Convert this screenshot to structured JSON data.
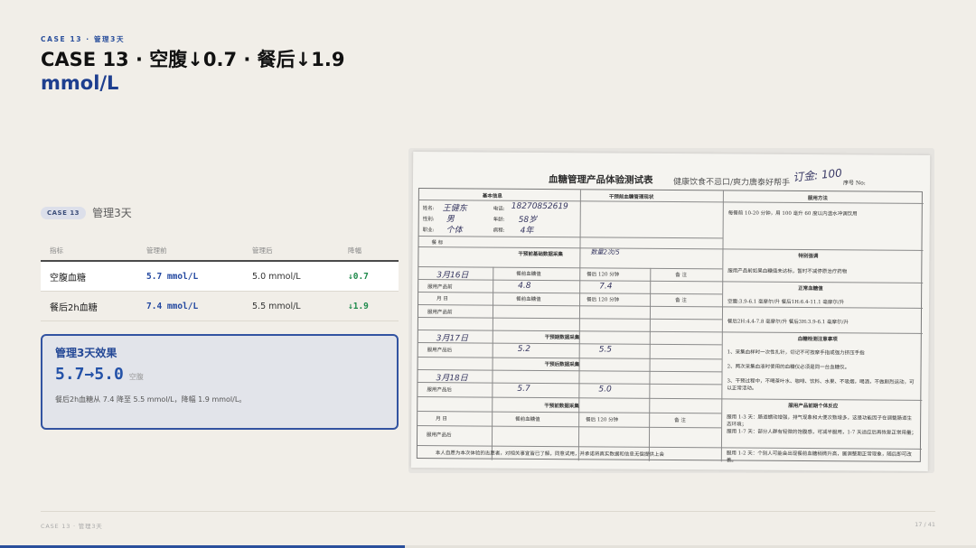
{
  "header": {
    "eyebrow": "CASE 13 · 管理3天",
    "title": "CASE 13 · 空腹↓0.7 · 餐后↓1.9",
    "title_unit": "mmol/L"
  },
  "case_tag": {
    "pill": "CASE 13",
    "label": "管理3天"
  },
  "table": {
    "headers": [
      "指标",
      "管理前",
      "管理后",
      "降幅"
    ],
    "rows": [
      {
        "metric": "空腹血糖",
        "before": "5.7 mmol/L",
        "after": "5.0 mmol/L",
        "drop": "↓0.7"
      },
      {
        "metric": "餐后2h血糖",
        "before": "7.4 mmol/L",
        "after": "5.5 mmol/L",
        "drop": "↓1.9"
      }
    ]
  },
  "effect": {
    "heading": "管理3天效果",
    "value": "5.7→5.0",
    "value_label": "空腹",
    "description": "餐后2h血糖从 7.4 降至 5.5 mmol/L，降幅 1.9 mmol/L。"
  },
  "photo": {
    "title": "血糖管理产品体验测试表",
    "slogan": "健康饮食不忌口/爽力唐泰好帮手",
    "seq": "序号 No:",
    "signature": "订金: 100",
    "sections": {
      "basic": "基本信息",
      "pre_status": "干预前血糖管理现状",
      "usage": "服用方法",
      "pre_data": "干预前基础数据采集",
      "special": "特别强调",
      "normal": "正常血糖值",
      "mid_data": "干预期数据采集",
      "mid_data2": "干预后数据采集",
      "post_data": "干预前数据采集",
      "notes": "血糖检测注意事项",
      "reaction": "服用产品前期个体反应"
    },
    "labels": {
      "name": "姓名:",
      "phone": "电话:",
      "gender": "性别:",
      "age": "年龄:",
      "job": "职业:",
      "course": "病程:",
      "meal": "餐 标",
      "date": "月 日",
      "fasting": "餐前血糖值",
      "post120": "餐后 120 分钟",
      "remark": "备 注",
      "before_use": "服用产品前",
      "after_use": "服用产品后"
    },
    "handwriting": {
      "name": "王健东",
      "phone": "18270852619",
      "gender": "男",
      "age": "58岁",
      "job": "个体",
      "course": "4年",
      "date1": "3月16日",
      "v1a": "4.8",
      "v1b": "7.4",
      "date2": "3月17日",
      "v2a": "5.2",
      "v2b": "5.5",
      "date3": "3月18日",
      "v3a": "5.7",
      "v3b": "5.0",
      "note_top": "数量2次/5"
    },
    "printed": {
      "usage_text": "每餐前 10-20 分钟，用 100 毫升 60 度以内温水冲调饮用",
      "special_text": "服用产品前如果血糖值未达标，暂时不减停原治疗药物",
      "normal_text1": "空腹:3.9-6.1 毫摩尔/升  餐后1H:6.4-11.1 毫摩尔/升",
      "normal_text2": "餐后2H:4.4-7.8 毫摩尔/升  餐后3H:3.9-6.1 毫摩尔/升",
      "note1": "1、采集血样时一次性扎针，切记不可按摩手指或强力挤压手指",
      "note2": "2、两次采集血液时使用的血糖仪必须是同一台血糖仪。",
      "note3": "3、干预过程中，不喝茶叶水、咖啡、饮料、水果、不吸烟，喝酒，不做剧烈运动，可以正常活动。",
      "react1": "服用 1-3 天：肠道蠕动增强，排气现象和大便次数增多，这是功能因子在调整肠道生态环境；",
      "react2": "服用 1-7 天：部分人群有轻微的饱腹感，可减半服用，1-7 天适应后再恢复正常用量；",
      "react3": "服用 1-2 天：个别人可能会出现餐前血糖稍微升高，属调整期正常现象，随后即可改善。",
      "consent": "本人自愿为本次体验的志愿者，对相关事宜皆已了解，同意试用，并承诺将真实数据和信息无偿提供上会"
    }
  },
  "footer": {
    "left": "CASE 13 · 管理3天",
    "page": "17 / 41",
    "progress": 0.415
  },
  "colors": {
    "accent": "#2a4f9c",
    "green": "#1f8a4c",
    "background": "#f1eee8"
  }
}
